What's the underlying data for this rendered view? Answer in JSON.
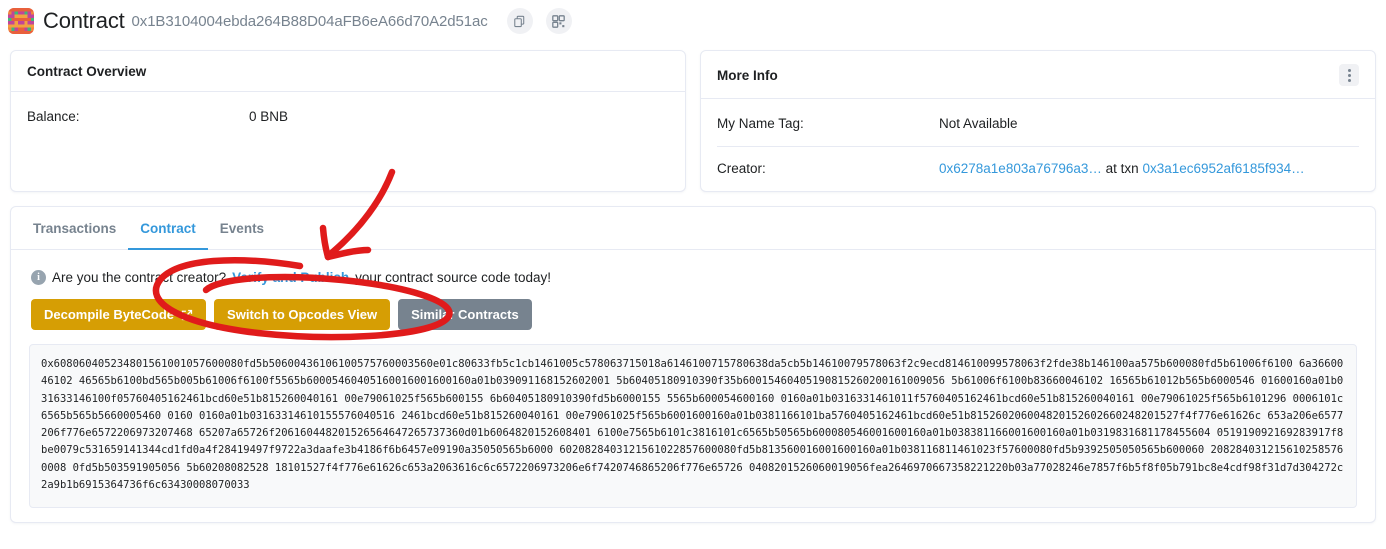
{
  "header": {
    "title": "Contract",
    "address": "0x1B3104004ebda264B88D04aFB6eA66d70A2d51ac",
    "copy_icon": "copy-icon",
    "qr_icon": "qr-code-icon",
    "identicon": "blockie-identicon"
  },
  "overview": {
    "title": "Contract Overview",
    "balance_label": "Balance:",
    "balance_value": "0 BNB"
  },
  "more_info": {
    "title": "More Info",
    "menu_icon": "kebab-menu-icon",
    "name_tag_label": "My Name Tag:",
    "name_tag_value": "Not Available",
    "creator_label": "Creator:",
    "creator_address": "0x6278a1e803a76796a3…",
    "creator_at_txn": "at txn",
    "creator_txn": "0x3a1ec6952af6185f934…"
  },
  "tabs": [
    {
      "label": "Transactions",
      "active": false
    },
    {
      "label": "Contract",
      "active": true
    },
    {
      "label": "Events",
      "active": false
    }
  ],
  "verify_banner": {
    "info_icon": "info-icon",
    "text_before": "Are you the contract creator?",
    "link": "Verify and Publish",
    "text_after": "your contract source code today!"
  },
  "buttons": [
    {
      "label": "Decompile ByteCode",
      "style": "amber",
      "icon": "external-link-icon"
    },
    {
      "label": "Switch to Opcodes View",
      "style": "amber",
      "icon": ""
    },
    {
      "label": "Similar Contracts",
      "style": "gray",
      "icon": ""
    }
  ],
  "bytecode": "0x608060405234801561001057600080fd5b50600436106100575760003560e01c80633fb5c1cb1461005c578063715018a6146100715780638da5cb5b14610079578063f2c9ecd814610099578063f2fde38b146100aa575b600080fd5b61006f6100 6a3660046102 46565b6100bd565b005b61006f6100f5565b60005460405160016001600160a01b039091168152602001 5b60405180910390f35b60015460405190815260200161009056 5b61006f6100b83660046102 16565b61012b565b6000546 01600160a01b031633146100f05760405162461bcd60e51b815260040161 00e79061025f565b600155 6b60405180910390fd5b6000155 5565b600054600160 0160a01b0316331461011f5760405162461bcd60e51b815260040161 00e79061025f565b6101296 0006101c6565b565b5660005460 0160 0160a01b03163314610155576040516 2461bcd60e51b815260040161 00e79061025f565b6001600160a01b0381166101ba5760405162461bcd60e51b815260206004820152602660248201527f4f776e61626c 653a206e6577206f776e6572206973207468 65207a65726f206160448201526564647265737360d01b6064820152608401 6100e7565b6101c3816101c6565b50565b600080546001600160a01b038381166001600160a01b0319831681178455604 051919092169283917f8be0079c531659141344cd1fd0a4f28419497f9722a3daafe3b4186f6b6457e09190a35050565b6000 6020828403121561022857600080fd5b813560016001600160a01b038116811461023f57600080fd5b9392505050565b600060 2082840312156102585760008 0fd5b503591905056 5b60208082528 18101527f4f776e61626c653a2063616c6c6572206973206e6f7420746865206f776e65726 0408201526060019056fea2646970667358221220b03a77028246e7857f6b5f8f05b791bc8e4cdf98f31d7d304272c2a9b1b6915364736f6c63430008070033"
}
